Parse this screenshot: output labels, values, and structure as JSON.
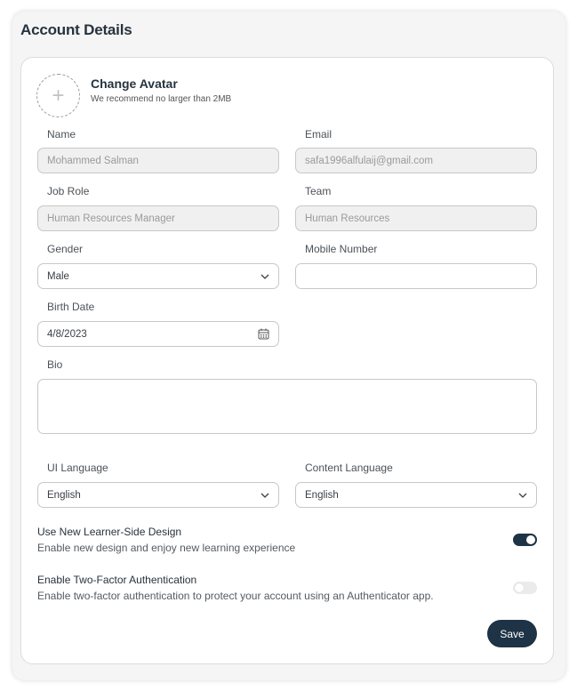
{
  "page_title": "Account Details",
  "avatar": {
    "title": "Change Avatar",
    "hint": "We recommend no larger than 2MB",
    "icon": "plus-icon"
  },
  "form": {
    "name": {
      "label": "Name",
      "value": "Mohammed Salman"
    },
    "email": {
      "label": "Email",
      "value": "safa1996alfulaij@gmail.com"
    },
    "job_role": {
      "label": "Job Role",
      "value": "Human Resources Manager"
    },
    "team": {
      "label": "Team",
      "value": "Human Resources"
    },
    "gender": {
      "label": "Gender",
      "value": "Male"
    },
    "mobile": {
      "label": "Mobile Number",
      "value": ""
    },
    "birth_date": {
      "label": "Birth Date",
      "value": "4/8/2023"
    },
    "bio": {
      "label": "Bio",
      "value": ""
    },
    "ui_language": {
      "label": "UI Language",
      "value": "English"
    },
    "content_language": {
      "label": "Content Language",
      "value": "English"
    }
  },
  "toggles": {
    "learner_design": {
      "title": "Use New Learner-Side Design",
      "description": "Enable new design and enjoy new learning experience",
      "enabled": true
    },
    "two_factor": {
      "title": "Enable Two-Factor Authentication",
      "description": "Enable two-factor authentication to protect your account using an Authenticator app.",
      "enabled": false
    }
  },
  "save_label": "Save",
  "colors": {
    "accent": "#1e3345",
    "toggle_off": "#ebebeb",
    "disabled_field": "#f0f0f0"
  }
}
